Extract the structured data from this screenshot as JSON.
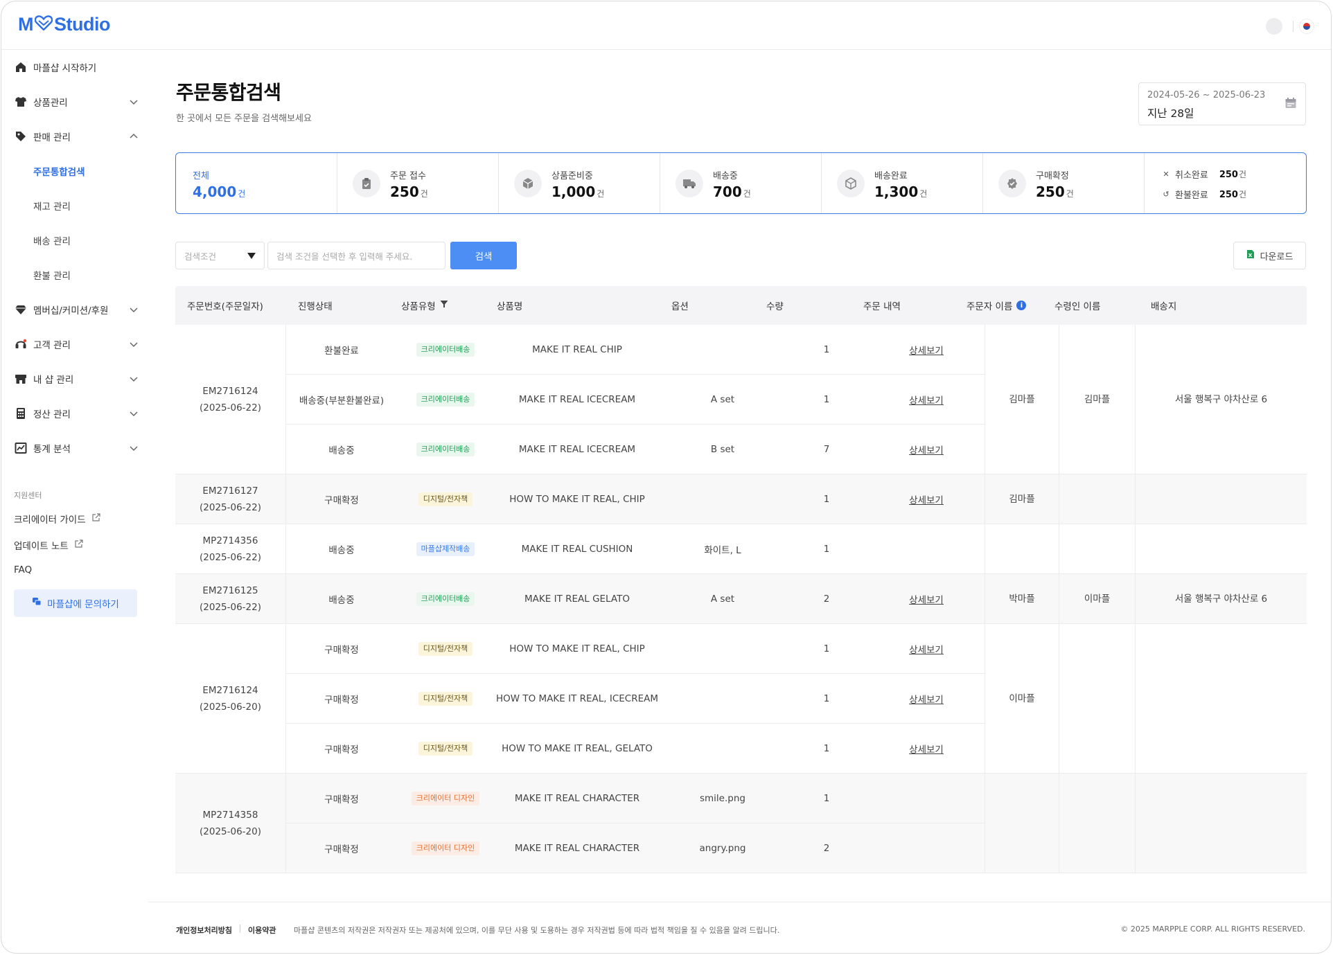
{
  "app": {
    "logo_m": "M",
    "logo_studio": "Studio"
  },
  "sidebar": {
    "items": [
      {
        "label": "마플샵 시작하기",
        "icon": "home-icon"
      },
      {
        "label": "상품관리",
        "icon": "shirt-icon"
      },
      {
        "label": "판매 관리",
        "icon": "tag-icon"
      },
      {
        "label": "멤버십/커미션/후원",
        "icon": "diamond-icon"
      },
      {
        "label": "고객 관리",
        "icon": "headset-icon"
      },
      {
        "label": "내 샵 관리",
        "icon": "shop-icon"
      },
      {
        "label": "정산 관리",
        "icon": "calculator-icon"
      },
      {
        "label": "통계 분석",
        "icon": "chart-icon"
      }
    ],
    "sales_sub": [
      "주문통합검색",
      "재고 관리",
      "배송 관리",
      "환불 관리"
    ],
    "support_label": "지원센터",
    "support_links": [
      "크리에이터 가이드",
      "업데이트 노트",
      "FAQ"
    ],
    "inquiry_button": "마플샵에 문의하기"
  },
  "page": {
    "title": "주문통합검색",
    "subtitle": "한 곳에서 모든 주문을 검색해보세요",
    "date_range": "2024-05-26 ~ 2025-06-23",
    "date_label": "지난 28일"
  },
  "stats": {
    "unit": "건",
    "items": [
      {
        "label": "전체",
        "value": "4,000",
        "icon": ""
      },
      {
        "label": "주문 접수",
        "value": "250",
        "icon": "clipboard-check-icon"
      },
      {
        "label": "상품준비중",
        "value": "1,000",
        "icon": "box-icon"
      },
      {
        "label": "배송중",
        "value": "700",
        "icon": "truck-icon"
      },
      {
        "label": "배송완료",
        "value": "1,300",
        "icon": "box-check-icon"
      },
      {
        "label": "구매확정",
        "value": "250",
        "icon": "badge-check-icon"
      }
    ],
    "mini": [
      {
        "label": "취소완료",
        "value": "250",
        "icon": "x-icon"
      },
      {
        "label": "환불완료",
        "value": "250",
        "icon": "undo-icon"
      }
    ]
  },
  "search": {
    "select_placeholder": "검색조건",
    "input_placeholder": "검색 조건을 선택한 후 입력해 주세요.",
    "search_button": "검색",
    "download_button": "다운로드"
  },
  "table": {
    "headers": [
      "주문번호(주문일자)",
      "진행상태",
      "상품유형",
      "상품명",
      "옵션",
      "수량",
      "주문 내역",
      "주문자 이름",
      "수령인 이름",
      "배송지"
    ],
    "detail_label": "상세보기",
    "groups": [
      {
        "order_no": "EM2716124",
        "order_date": "(2025-06-22)",
        "orderer": "김마플",
        "receiver": "김마플",
        "address": "서울 행복구 야차산로 6",
        "rows": [
          {
            "status": "환불완료",
            "type": "크리에이터배송",
            "type_color": "green",
            "product": "MAKE IT REAL CHIP",
            "option": "",
            "qty": "1",
            "detail": true
          },
          {
            "status": "배송중(부분환불완료)",
            "type": "크리에이터배송",
            "type_color": "green",
            "product": "MAKE IT REAL ICECREAM",
            "option": "A set",
            "qty": "1",
            "detail": true
          },
          {
            "status": "배송중",
            "type": "크리에이터배송",
            "type_color": "green",
            "product": "MAKE IT REAL ICECREAM",
            "option": "B set",
            "qty": "7",
            "detail": true
          }
        ]
      },
      {
        "order_no": "EM2716127",
        "order_date": "(2025-06-22)",
        "orderer": "김마플",
        "receiver": "",
        "address": "",
        "rows": [
          {
            "status": "구매확정",
            "type": "디지털/전자책",
            "type_color": "yellow",
            "product": "HOW TO MAKE IT REAL, CHIP",
            "option": "",
            "qty": "1",
            "detail": true
          }
        ]
      },
      {
        "order_no": "MP2714356",
        "order_date": "(2025-06-22)",
        "orderer": "",
        "receiver": "",
        "address": "",
        "rows": [
          {
            "status": "배송중",
            "type": "마플샵제작배송",
            "type_color": "blue",
            "product": "MAKE IT REAL CUSHION",
            "option": "화이트, L",
            "qty": "1",
            "detail": false
          }
        ]
      },
      {
        "order_no": "EM2716125",
        "order_date": "(2025-06-22)",
        "orderer": "박마플",
        "receiver": "이마플",
        "address": "서울 행복구 야차산로 6",
        "rows": [
          {
            "status": "배송중",
            "type": "크리에이터배송",
            "type_color": "green",
            "product": "MAKE IT REAL GELATO",
            "option": "A set",
            "qty": "2",
            "detail": true
          }
        ]
      },
      {
        "order_no": "EM2716124",
        "order_date": "(2025-06-20)",
        "orderer": "이마플",
        "receiver": "",
        "address": "",
        "rows": [
          {
            "status": "구매확정",
            "type": "디지털/전자책",
            "type_color": "yellow",
            "product": "HOW TO MAKE IT REAL, CHIP",
            "option": "",
            "qty": "1",
            "detail": true
          },
          {
            "status": "구매확정",
            "type": "디지털/전자책",
            "type_color": "yellow",
            "product": "HOW TO MAKE IT REAL, ICECREAM",
            "option": "",
            "qty": "1",
            "detail": true
          },
          {
            "status": "구매확정",
            "type": "디지털/전자책",
            "type_color": "yellow",
            "product": "HOW TO MAKE IT REAL, GELATO",
            "option": "",
            "qty": "1",
            "detail": true
          }
        ]
      },
      {
        "order_no": "MP2714358",
        "order_date": "(2025-06-20)",
        "orderer": "",
        "receiver": "",
        "address": "",
        "rows": [
          {
            "status": "구매확정",
            "type": "크리에이터 디자인",
            "type_color": "orange",
            "product": "MAKE IT REAL CHARACTER",
            "option": "smile.png",
            "qty": "1",
            "detail": false
          },
          {
            "status": "구매확정",
            "type": "크리에이터 디자인",
            "type_color": "orange",
            "product": "MAKE IT REAL CHARACTER",
            "option": "angry.png",
            "qty": "2",
            "detail": false
          }
        ]
      }
    ]
  },
  "footer": {
    "privacy": "개인정보처리방침",
    "terms": "이용약관",
    "notice": "마플샵 콘텐츠의 저작권은 저작권자 또는 제공처에 있으며, 이를 무단 사용 및 도용하는 경우 저작권법 등에 따라 법적 책임을 질 수 있음을 알려 드립니다.",
    "copyright": "© 2025 MARPPLE CORP. ALL RIGHTS RESERVED."
  },
  "colors": {
    "accent": "#2f6fe4",
    "search_button": "#4d8ef5",
    "border": "#ececef"
  }
}
